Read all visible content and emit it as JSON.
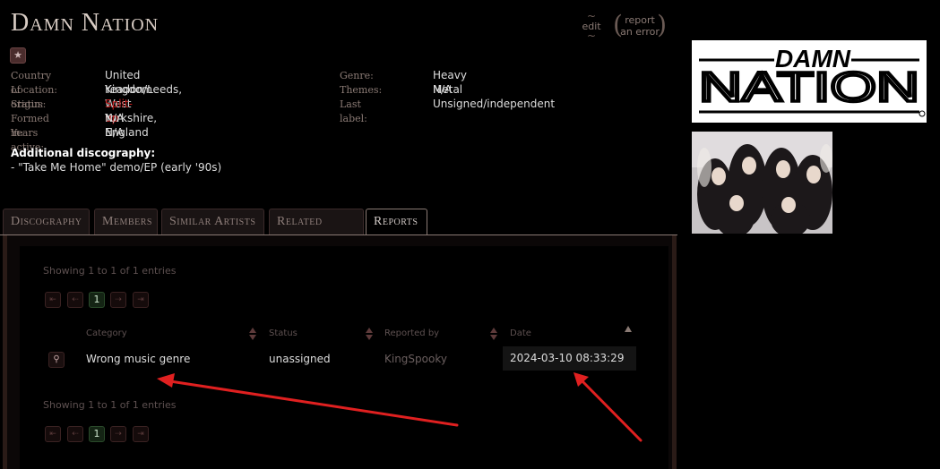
{
  "header": {
    "band_name": "Damn Nation",
    "edit_label": "edit",
    "report_label_1": "report",
    "report_label_2": "an error"
  },
  "details": {
    "country_label": "Country of origin:",
    "country": "United Kingdom",
    "location_label": "Location:",
    "location": "Yeadon/Leeds, West Yorkshire, England",
    "status_label": "Status:",
    "status": "Split-up",
    "formed_label": "Formed in:",
    "formed": "N/A",
    "years_label": "Years active:",
    "years": "N/A",
    "genre_label": "Genre:",
    "genre": "Heavy Metal",
    "themes_label": "Themes:",
    "themes": "N/A",
    "label_label": "Last label:",
    "last_label": "Unsigned/independent"
  },
  "additional": {
    "heading": "Additional discography:",
    "item": "- \"Take Me Home\" demo/EP (early '90s)"
  },
  "tabs": [
    {
      "label": "Discography"
    },
    {
      "label": "Members"
    },
    {
      "label": "Similar Artists"
    },
    {
      "label": "Related Links"
    },
    {
      "label": "Reports"
    }
  ],
  "reports": {
    "showing_top": "Showing 1 to 1 of 1 entries",
    "showing_bottom": "Showing 1 to 1 of 1 entries",
    "pager": {
      "first": "⇤",
      "prev": "⇠",
      "page": "1",
      "next": "⇢",
      "last": "⇥"
    },
    "columns": [
      "Category",
      "Status",
      "Reported by",
      "Date"
    ],
    "rows": [
      {
        "category": "Wrong music genre",
        "status": "unassigned",
        "reported_by": "KingSpooky",
        "date": "2024-03-10 08:33:29"
      }
    ]
  },
  "logo": {
    "line1": "DAMN",
    "line2": "NATION"
  },
  "colors": {
    "accent": "#c21a1a",
    "annotation_arrow": "#e02020"
  },
  "icons": {
    "favorite": "star-icon",
    "row_detail": "magnifier-icon"
  }
}
